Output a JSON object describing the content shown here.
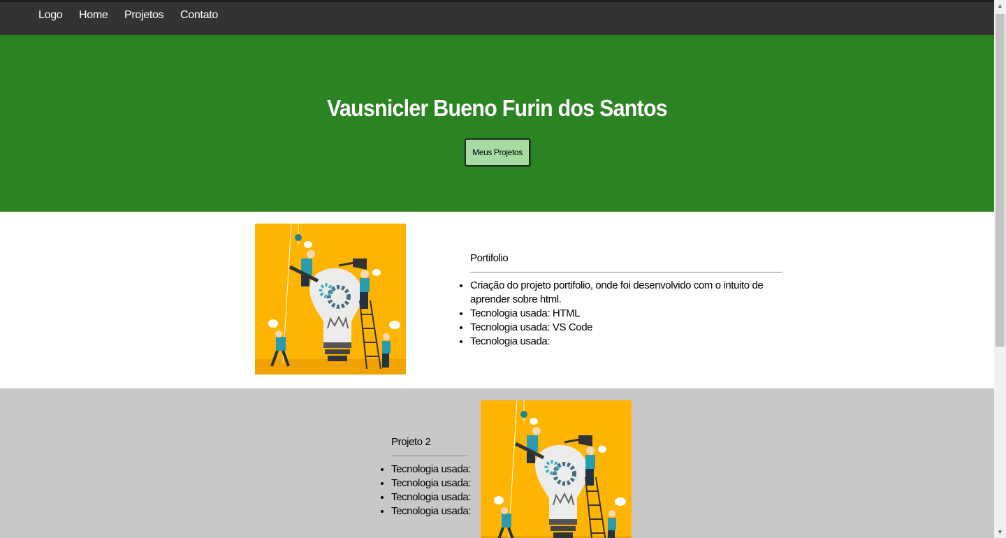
{
  "nav": {
    "items": [
      "Logo",
      "Home",
      "Projetos",
      "Contato"
    ]
  },
  "hero": {
    "title": "Vausnicler Bueno Furin dos Santos",
    "button_label": "Meus Projetos"
  },
  "projects": [
    {
      "title": "Portifolio",
      "bullets": [
        "Criação do projeto portifolio, onde foi desenvolvido com o intuito de aprender sobre html.",
        "Tecnologia usada: HTML",
        "Tecnologia usada: VS Code",
        "Tecnologia usada:"
      ]
    },
    {
      "title": "Projeto 2",
      "bullets": [
        "Tecnologia usada:",
        "Tecnologia usada:",
        "Tecnologia usada:",
        "Tecnologia usada:"
      ]
    }
  ],
  "colors": {
    "nav_bg": "#333333",
    "hero_bg": "#2a8422",
    "button_bg": "#a8dba2",
    "section2_bg": "#c8c8c8",
    "illustration_bg": "#ffb400"
  },
  "icons": {
    "scroll_up": "triangle-up",
    "scroll_down": "triangle-down"
  }
}
